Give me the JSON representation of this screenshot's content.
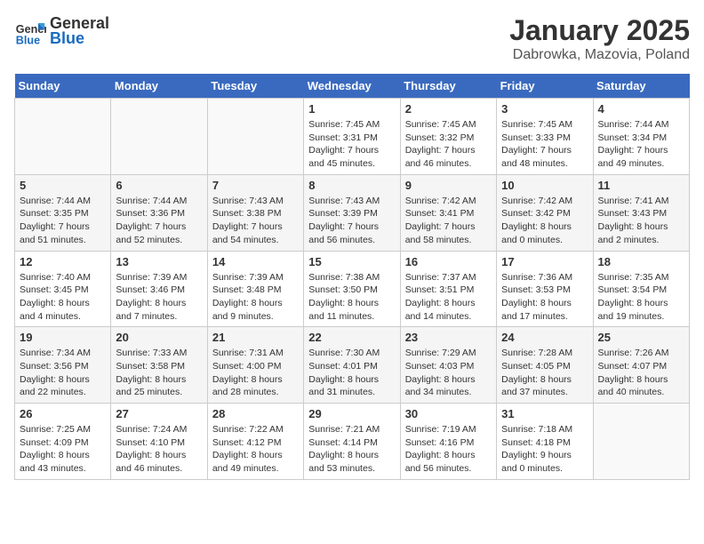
{
  "header": {
    "logo_general": "General",
    "logo_blue": "Blue",
    "month": "January 2025",
    "location": "Dabrowka, Mazovia, Poland"
  },
  "weekdays": [
    "Sunday",
    "Monday",
    "Tuesday",
    "Wednesday",
    "Thursday",
    "Friday",
    "Saturday"
  ],
  "weeks": [
    [
      {
        "day": "",
        "info": ""
      },
      {
        "day": "",
        "info": ""
      },
      {
        "day": "",
        "info": ""
      },
      {
        "day": "1",
        "info": "Sunrise: 7:45 AM\nSunset: 3:31 PM\nDaylight: 7 hours and 45 minutes."
      },
      {
        "day": "2",
        "info": "Sunrise: 7:45 AM\nSunset: 3:32 PM\nDaylight: 7 hours and 46 minutes."
      },
      {
        "day": "3",
        "info": "Sunrise: 7:45 AM\nSunset: 3:33 PM\nDaylight: 7 hours and 48 minutes."
      },
      {
        "day": "4",
        "info": "Sunrise: 7:44 AM\nSunset: 3:34 PM\nDaylight: 7 hours and 49 minutes."
      }
    ],
    [
      {
        "day": "5",
        "info": "Sunrise: 7:44 AM\nSunset: 3:35 PM\nDaylight: 7 hours and 51 minutes."
      },
      {
        "day": "6",
        "info": "Sunrise: 7:44 AM\nSunset: 3:36 PM\nDaylight: 7 hours and 52 minutes."
      },
      {
        "day": "7",
        "info": "Sunrise: 7:43 AM\nSunset: 3:38 PM\nDaylight: 7 hours and 54 minutes."
      },
      {
        "day": "8",
        "info": "Sunrise: 7:43 AM\nSunset: 3:39 PM\nDaylight: 7 hours and 56 minutes."
      },
      {
        "day": "9",
        "info": "Sunrise: 7:42 AM\nSunset: 3:41 PM\nDaylight: 7 hours and 58 minutes."
      },
      {
        "day": "10",
        "info": "Sunrise: 7:42 AM\nSunset: 3:42 PM\nDaylight: 8 hours and 0 minutes."
      },
      {
        "day": "11",
        "info": "Sunrise: 7:41 AM\nSunset: 3:43 PM\nDaylight: 8 hours and 2 minutes."
      }
    ],
    [
      {
        "day": "12",
        "info": "Sunrise: 7:40 AM\nSunset: 3:45 PM\nDaylight: 8 hours and 4 minutes."
      },
      {
        "day": "13",
        "info": "Sunrise: 7:39 AM\nSunset: 3:46 PM\nDaylight: 8 hours and 7 minutes."
      },
      {
        "day": "14",
        "info": "Sunrise: 7:39 AM\nSunset: 3:48 PM\nDaylight: 8 hours and 9 minutes."
      },
      {
        "day": "15",
        "info": "Sunrise: 7:38 AM\nSunset: 3:50 PM\nDaylight: 8 hours and 11 minutes."
      },
      {
        "day": "16",
        "info": "Sunrise: 7:37 AM\nSunset: 3:51 PM\nDaylight: 8 hours and 14 minutes."
      },
      {
        "day": "17",
        "info": "Sunrise: 7:36 AM\nSunset: 3:53 PM\nDaylight: 8 hours and 17 minutes."
      },
      {
        "day": "18",
        "info": "Sunrise: 7:35 AM\nSunset: 3:54 PM\nDaylight: 8 hours and 19 minutes."
      }
    ],
    [
      {
        "day": "19",
        "info": "Sunrise: 7:34 AM\nSunset: 3:56 PM\nDaylight: 8 hours and 22 minutes."
      },
      {
        "day": "20",
        "info": "Sunrise: 7:33 AM\nSunset: 3:58 PM\nDaylight: 8 hours and 25 minutes."
      },
      {
        "day": "21",
        "info": "Sunrise: 7:31 AM\nSunset: 4:00 PM\nDaylight: 8 hours and 28 minutes."
      },
      {
        "day": "22",
        "info": "Sunrise: 7:30 AM\nSunset: 4:01 PM\nDaylight: 8 hours and 31 minutes."
      },
      {
        "day": "23",
        "info": "Sunrise: 7:29 AM\nSunset: 4:03 PM\nDaylight: 8 hours and 34 minutes."
      },
      {
        "day": "24",
        "info": "Sunrise: 7:28 AM\nSunset: 4:05 PM\nDaylight: 8 hours and 37 minutes."
      },
      {
        "day": "25",
        "info": "Sunrise: 7:26 AM\nSunset: 4:07 PM\nDaylight: 8 hours and 40 minutes."
      }
    ],
    [
      {
        "day": "26",
        "info": "Sunrise: 7:25 AM\nSunset: 4:09 PM\nDaylight: 8 hours and 43 minutes."
      },
      {
        "day": "27",
        "info": "Sunrise: 7:24 AM\nSunset: 4:10 PM\nDaylight: 8 hours and 46 minutes."
      },
      {
        "day": "28",
        "info": "Sunrise: 7:22 AM\nSunset: 4:12 PM\nDaylight: 8 hours and 49 minutes."
      },
      {
        "day": "29",
        "info": "Sunrise: 7:21 AM\nSunset: 4:14 PM\nDaylight: 8 hours and 53 minutes."
      },
      {
        "day": "30",
        "info": "Sunrise: 7:19 AM\nSunset: 4:16 PM\nDaylight: 8 hours and 56 minutes."
      },
      {
        "day": "31",
        "info": "Sunrise: 7:18 AM\nSunset: 4:18 PM\nDaylight: 9 hours and 0 minutes."
      },
      {
        "day": "",
        "info": ""
      }
    ]
  ]
}
